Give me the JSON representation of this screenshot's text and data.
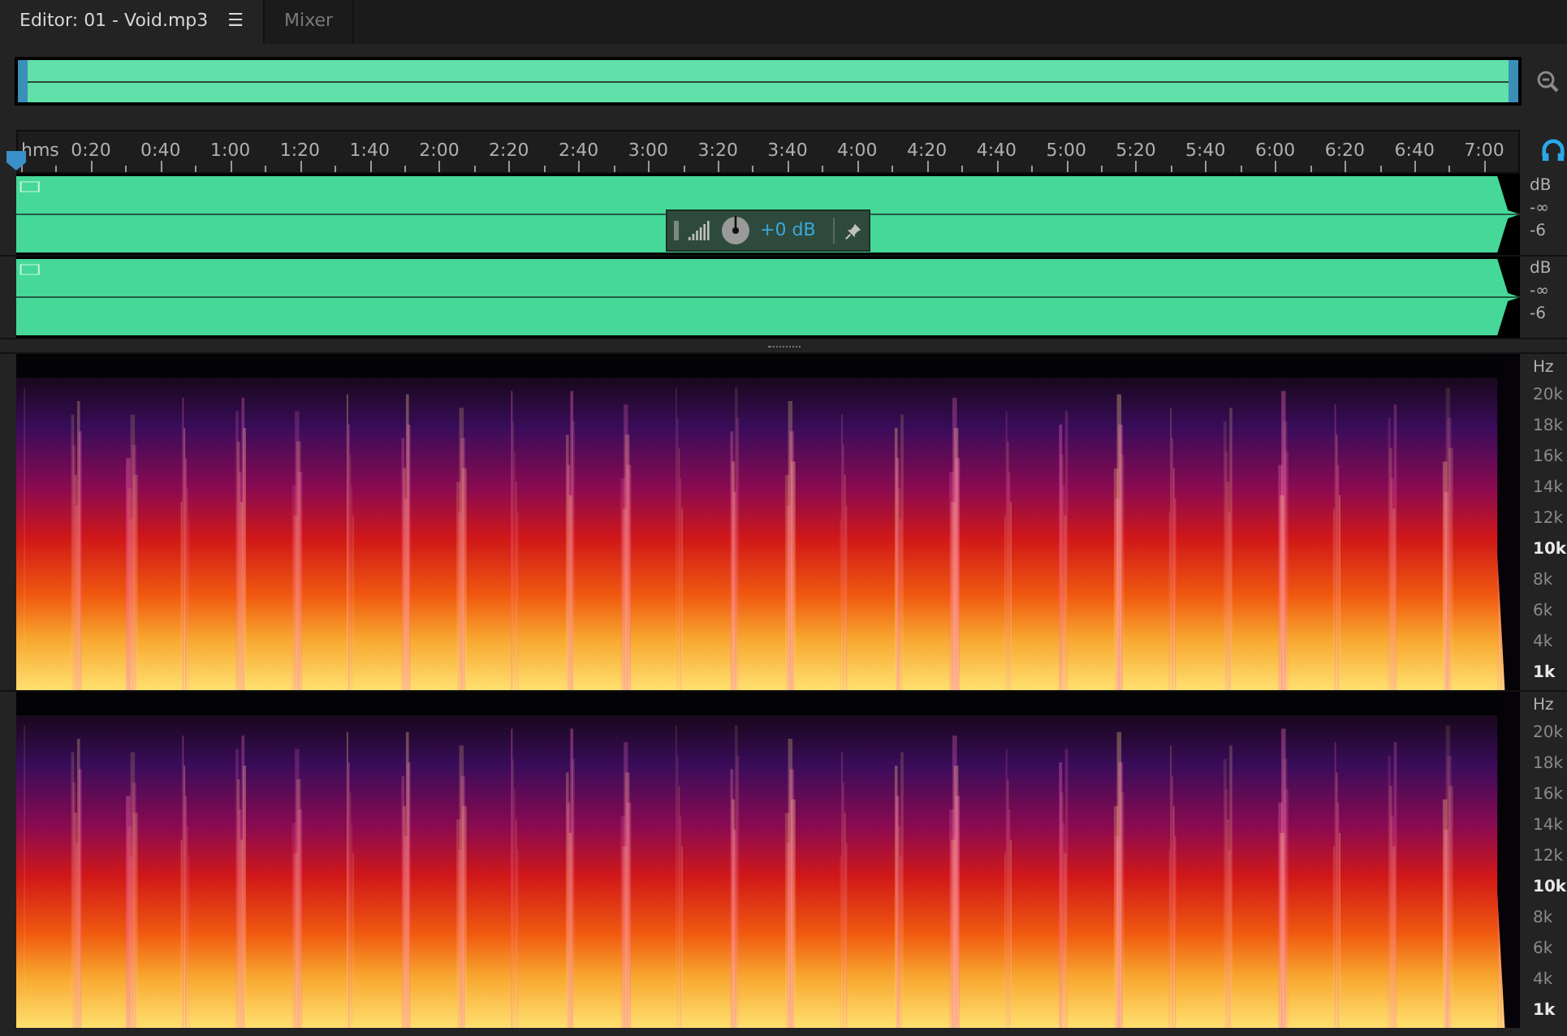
{
  "tabs": [
    {
      "label": "Editor: 01 - Void.mp3",
      "selected": true,
      "menu": "☰"
    },
    {
      "label": "Mixer",
      "selected": false
    }
  ],
  "ruler": {
    "unit": "hms",
    "labels": [
      "0:20",
      "0:40",
      "1:00",
      "1:20",
      "1:40",
      "2:00",
      "2:20",
      "2:40",
      "3:00",
      "3:20",
      "3:40",
      "4:00",
      "4:20",
      "4:40",
      "5:00",
      "5:20",
      "5:40",
      "6:00",
      "6:20",
      "6:40",
      "7:00"
    ]
  },
  "hud": {
    "reading": "+0 dB"
  },
  "channels": [
    {
      "labels": [
        "dB",
        "-∞",
        "-6"
      ]
    },
    {
      "labels": [
        "dB",
        "-∞",
        "-6"
      ]
    }
  ],
  "spectrograms": [
    {
      "unit": "Hz",
      "labels": [
        {
          "text": "20k",
          "bold": false
        },
        {
          "text": "18k",
          "bold": false
        },
        {
          "text": "16k",
          "bold": false
        },
        {
          "text": "14k",
          "bold": false
        },
        {
          "text": "12k",
          "bold": false
        },
        {
          "text": "10k",
          "bold": true
        },
        {
          "text": "8k",
          "bold": false
        },
        {
          "text": "6k",
          "bold": false
        },
        {
          "text": "4k",
          "bold": false
        },
        {
          "text": "1k",
          "bold": true
        }
      ]
    },
    {
      "unit": "Hz",
      "labels": [
        {
          "text": "20k",
          "bold": false
        },
        {
          "text": "18k",
          "bold": false
        },
        {
          "text": "16k",
          "bold": false
        },
        {
          "text": "14k",
          "bold": false
        },
        {
          "text": "12k",
          "bold": false
        },
        {
          "text": "10k",
          "bold": true
        },
        {
          "text": "8k",
          "bold": false
        },
        {
          "text": "6k",
          "bold": false
        },
        {
          "text": "4k",
          "bold": false
        },
        {
          "text": "1k",
          "bold": true
        }
      ]
    }
  ]
}
